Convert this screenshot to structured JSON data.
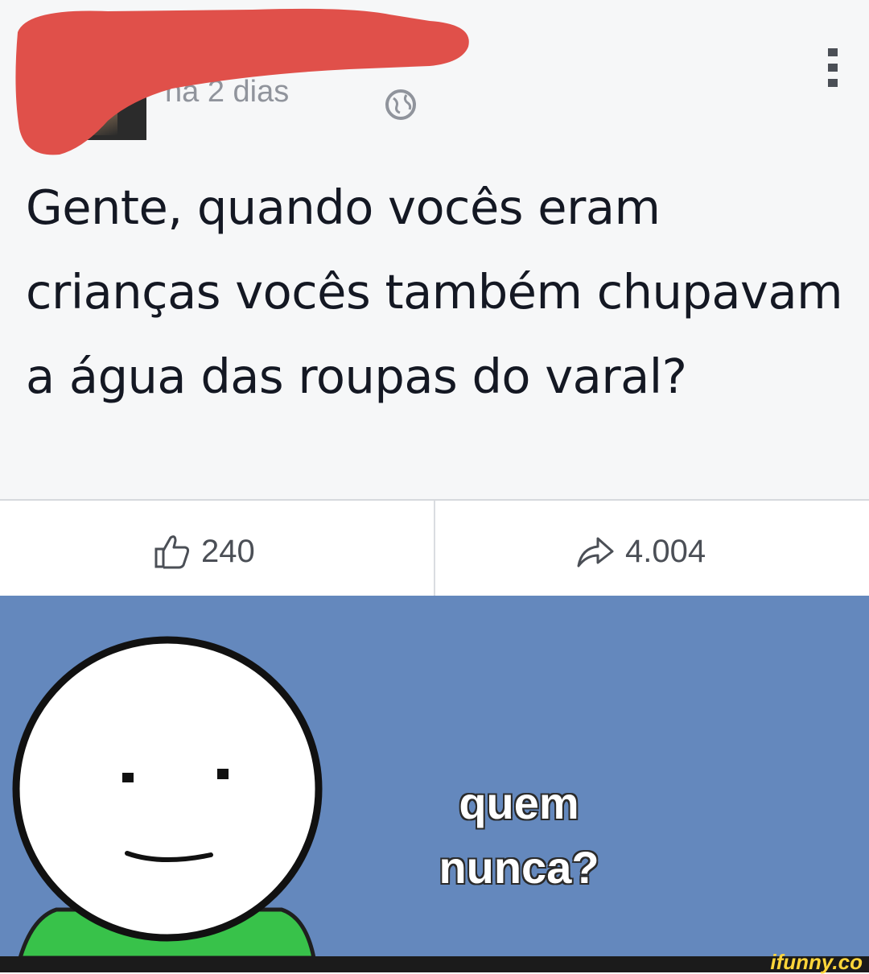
{
  "post": {
    "timestamp": "há 2 dias",
    "body": "Gente, quando vocês eram crianças vocês também chupavam a água das roupas do varal?",
    "actions": {
      "likes": "240",
      "shares": "4.004"
    }
  },
  "meme": {
    "line1": "quem",
    "line2": "nunca?"
  },
  "watermark": "ifunny.co",
  "colors": {
    "meme_background": "#6488bd",
    "redaction": "#e0504a",
    "watermark": "#ffd53a"
  }
}
